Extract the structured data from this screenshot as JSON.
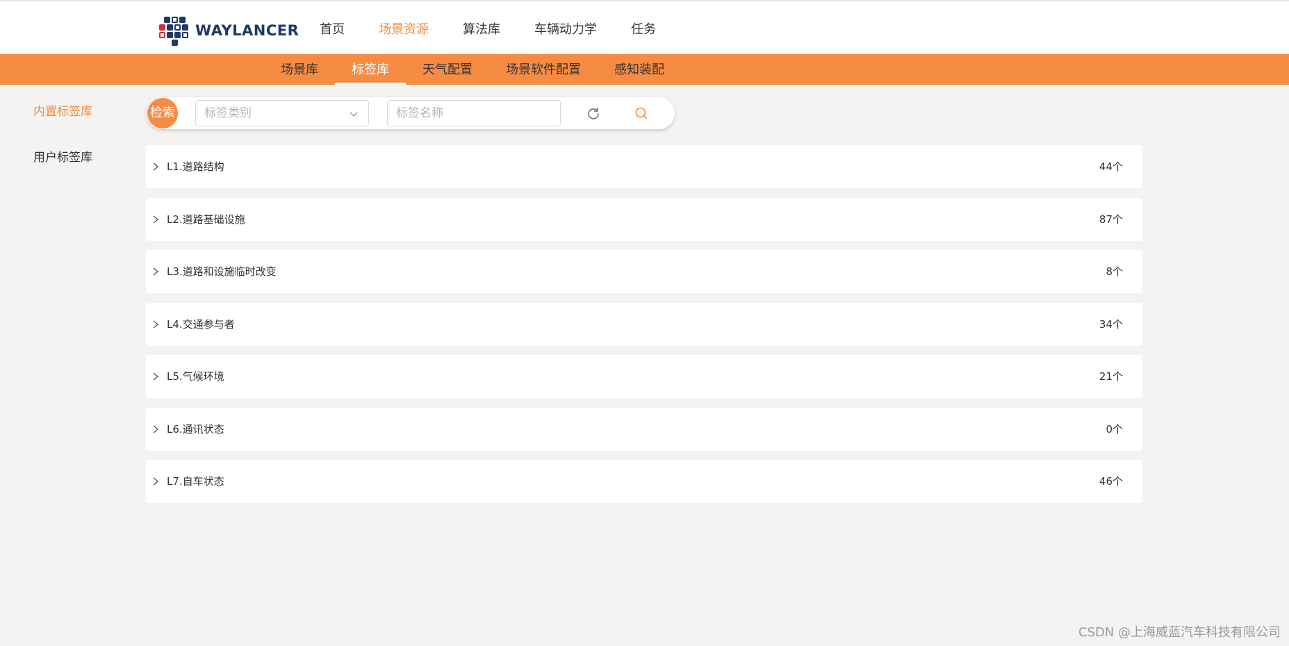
{
  "header": {
    "logo_text": "WAYLANCER",
    "nav": [
      {
        "label": "首页",
        "active": false
      },
      {
        "label": "场景资源",
        "active": true
      },
      {
        "label": "算法库",
        "active": false
      },
      {
        "label": "车辆动力学",
        "active": false
      },
      {
        "label": "任务",
        "active": false
      }
    ]
  },
  "subnav": {
    "items": [
      {
        "label": "场景库",
        "active": false
      },
      {
        "label": "标签库",
        "active": true
      },
      {
        "label": "天气配置",
        "active": false
      },
      {
        "label": "场景软件配置",
        "active": false
      },
      {
        "label": "感知装配",
        "active": false
      }
    ]
  },
  "sidebar": {
    "items": [
      {
        "label": "内置标签库",
        "active": true
      },
      {
        "label": "用户标签库",
        "active": false
      }
    ]
  },
  "search": {
    "badge": "检索",
    "category_placeholder": "标签类别",
    "name_placeholder": "标签名称",
    "name_value": ""
  },
  "tags": [
    {
      "label": "L1.道路结构",
      "count": "44个"
    },
    {
      "label": "L2.道路基础设施",
      "count": "87个"
    },
    {
      "label": "L3.道路和设施临时改变",
      "count": "8个"
    },
    {
      "label": "L4.交通参与者",
      "count": "34个"
    },
    {
      "label": "L5.气候环境",
      "count": "21个"
    },
    {
      "label": "L6.通讯状态",
      "count": "0个"
    },
    {
      "label": "L7.自车状态",
      "count": "46个"
    }
  ],
  "watermark": "CSDN @上海威蓝汽车科技有限公司",
  "colors": {
    "accent": "#f68b44",
    "active_text": "#f28a3e",
    "background": "#f4f3f2",
    "logo_blue": "#1c3a66",
    "logo_red": "#c8323c"
  }
}
